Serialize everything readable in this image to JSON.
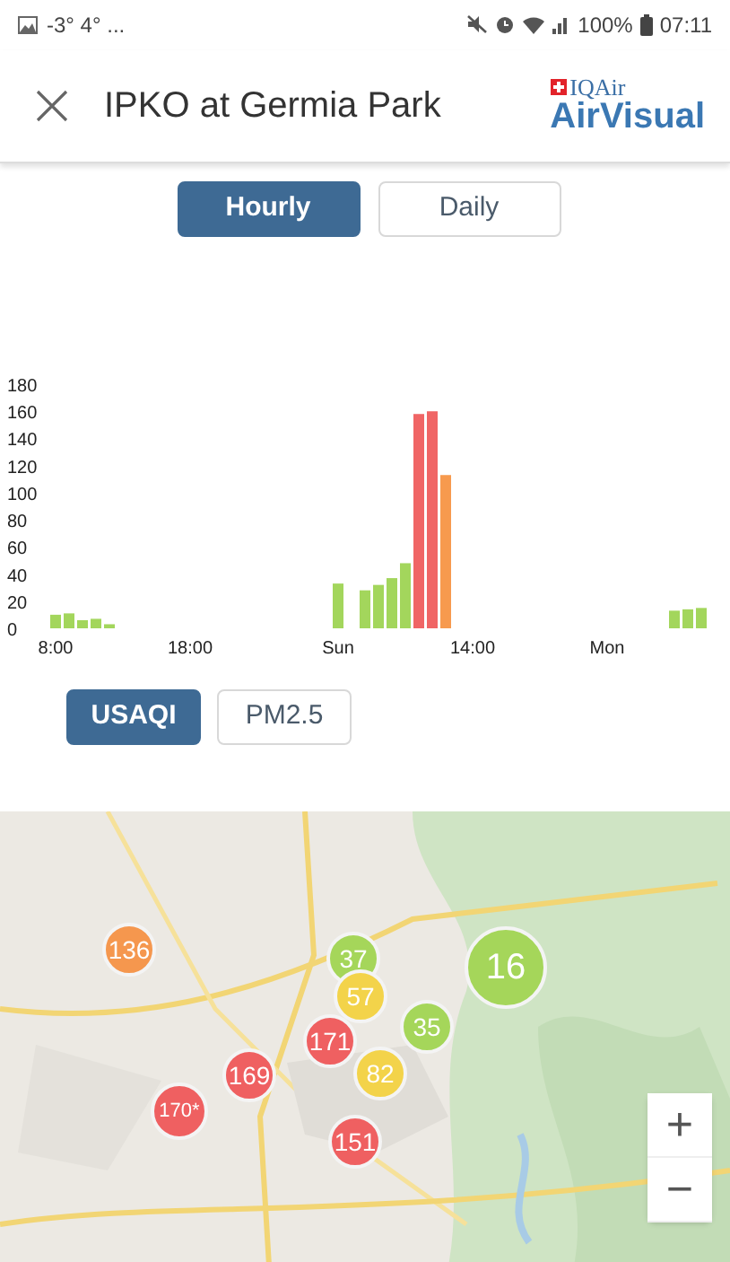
{
  "status_bar": {
    "weather": "-3° 4° ...",
    "battery": "100%",
    "time": "07:11"
  },
  "header": {
    "title": "IPKO at Germia Park",
    "brand_top": "IQAir",
    "brand": "AirVisual"
  },
  "period_tabs": [
    {
      "label": "Hourly",
      "selected": true
    },
    {
      "label": "Daily",
      "selected": false
    }
  ],
  "chart_data": {
    "type": "bar",
    "stacked": true,
    "categories": [
      "8:00",
      null,
      null,
      null,
      null,
      null,
      null,
      null,
      null,
      null,
      "18:00",
      null,
      null,
      null,
      null,
      null,
      null,
      null,
      null,
      null,
      null,
      "Sun",
      null,
      null,
      null,
      null,
      null,
      null,
      null,
      null,
      null,
      "14:00",
      null,
      null,
      null,
      null,
      null,
      null,
      null,
      null,
      null,
      "Mon",
      null,
      null,
      null,
      null,
      null,
      null,
      null
    ],
    "series": [
      {
        "color": "#a3d65c",
        "values": [
          10,
          11,
          6,
          7,
          3,
          null,
          null,
          null,
          null,
          null,
          null,
          null,
          null,
          null,
          null,
          null,
          null,
          null,
          null,
          null,
          null,
          33,
          null,
          28,
          32,
          37,
          48,
          null,
          null,
          null,
          null,
          null,
          null,
          null,
          null,
          null,
          null,
          null,
          null,
          null,
          null,
          null,
          null,
          null,
          null,
          null,
          13,
          14,
          15
        ]
      },
      {
        "color": "#f06565",
        "values": [
          null,
          null,
          null,
          null,
          null,
          null,
          null,
          null,
          null,
          null,
          null,
          null,
          null,
          null,
          null,
          null,
          null,
          null,
          null,
          null,
          null,
          null,
          null,
          null,
          null,
          null,
          null,
          158,
          160,
          null,
          null,
          null,
          null,
          null,
          null,
          null,
          null,
          null,
          null,
          null,
          null,
          null,
          null,
          null,
          null,
          null,
          null,
          null,
          null
        ]
      },
      {
        "color": "#f79a4e",
        "values": [
          null,
          null,
          null,
          null,
          null,
          null,
          null,
          null,
          null,
          null,
          null,
          null,
          null,
          null,
          null,
          null,
          null,
          null,
          null,
          null,
          null,
          null,
          null,
          null,
          null,
          null,
          null,
          null,
          null,
          113,
          null,
          null,
          null,
          null,
          null,
          null,
          null,
          null,
          null,
          null,
          null,
          null,
          null,
          null,
          null,
          null,
          null,
          null,
          null
        ]
      }
    ],
    "ylim": [
      0,
      180
    ],
    "yticks": [
      0,
      20,
      40,
      60,
      80,
      100,
      120,
      140,
      160,
      180
    ]
  },
  "metric_tabs": [
    {
      "label": "USAQI",
      "selected": true
    },
    {
      "label": "PM2.5",
      "selected": false
    }
  ],
  "map": {
    "kind": "picture",
    "markers": [
      {
        "value": "136",
        "color": "#f5974e"
      },
      {
        "value": "37",
        "color": "#a5d65a"
      },
      {
        "value": "57",
        "color": "#f3d34a"
      },
      {
        "value": "35",
        "color": "#a5d65a"
      },
      {
        "value": "16",
        "color": "#a5d65a"
      },
      {
        "value": "171",
        "color": "#ef6061"
      },
      {
        "value": "169",
        "color": "#ef6061"
      },
      {
        "value": "170*",
        "color": "#ef6061"
      },
      {
        "value": "82",
        "color": "#f3d34a"
      },
      {
        "value": "151",
        "color": "#ef6061"
      }
    ],
    "zoom_buttons": [
      "+",
      "−"
    ]
  }
}
